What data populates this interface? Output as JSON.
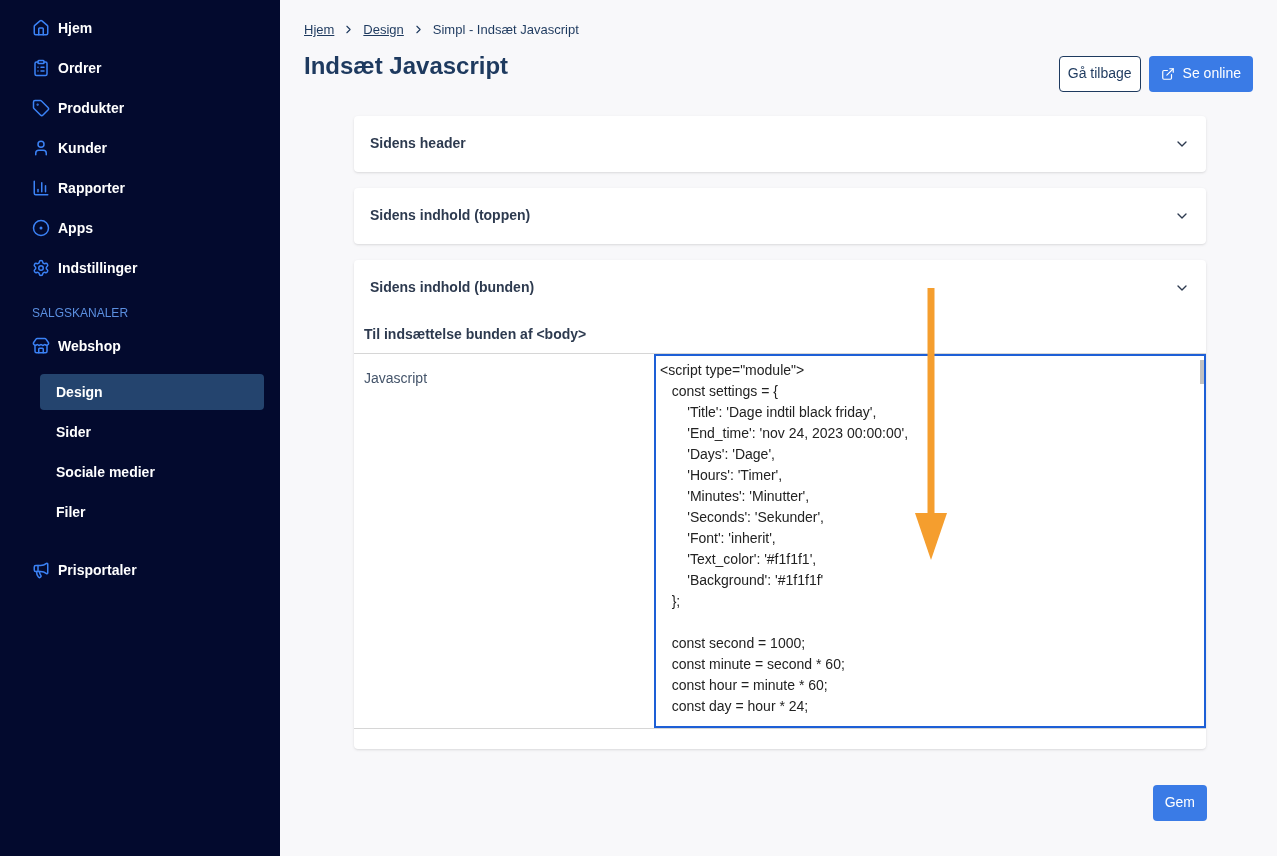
{
  "sidebar": {
    "items": [
      {
        "label": "Hjem",
        "selected": false
      },
      {
        "label": "Ordrer",
        "selected": false
      },
      {
        "label": "Produkter",
        "selected": false
      },
      {
        "label": "Kunder",
        "selected": false
      },
      {
        "label": "Rapporter",
        "selected": false
      },
      {
        "label": "Apps",
        "selected": false
      },
      {
        "label": "Indstillinger",
        "selected": false
      }
    ],
    "section_title": "SALGSKANALER",
    "channel": {
      "label": "Webshop",
      "selected": false
    },
    "sub_items": [
      {
        "label": "Design",
        "selected": true
      },
      {
        "label": "Sider",
        "selected": false
      },
      {
        "label": "Sociale medier",
        "selected": false
      },
      {
        "label": "Filer",
        "selected": false
      }
    ],
    "bottom_items": [
      {
        "label": "Prisportaler",
        "selected": false
      }
    ]
  },
  "breadcrumb": [
    {
      "label": "Hjem",
      "link": true
    },
    {
      "label": "Design",
      "link": true
    },
    {
      "label": "Simpl - Indsæt Javascript",
      "link": false
    }
  ],
  "page_title": "Indsæt Javascript",
  "actions": [
    {
      "label": "Gå tilbage",
      "kind": "outline"
    },
    {
      "label": "Se online",
      "kind": "primary"
    }
  ],
  "panels": [
    {
      "title": "Sidens header",
      "expanded": false
    },
    {
      "title": "Sidens indhold (toppen)",
      "expanded": false
    },
    {
      "title": "Sidens indhold (bunden)",
      "expanded": true,
      "subtitle": "Til indsættelse bunden af <body>",
      "field_label": "Javascript",
      "code_blocks": [
        [
          "<script type=\"module\">",
          "   const settings = {",
          "       'Title': 'Dage indtil black friday',",
          "       'End_time': 'nov 24, 2023 00:00:00',",
          "       'Days': 'Dage',",
          "       'Hours': 'Timer',",
          "       'Minutes': 'Minutter',",
          "       'Seconds': 'Sekunder',",
          "       'Font': 'inherit',",
          "       'Text_color': '#f1f1f1',",
          "       'Background': '#1f1f1f'",
          "   };"
        ],
        [
          "   const second = 1000;",
          "   const minute = second * 60;",
          "   const hour = minute * 60;",
          "   const day = hour * 24;"
        ]
      ]
    }
  ],
  "save_button": "Gem"
}
